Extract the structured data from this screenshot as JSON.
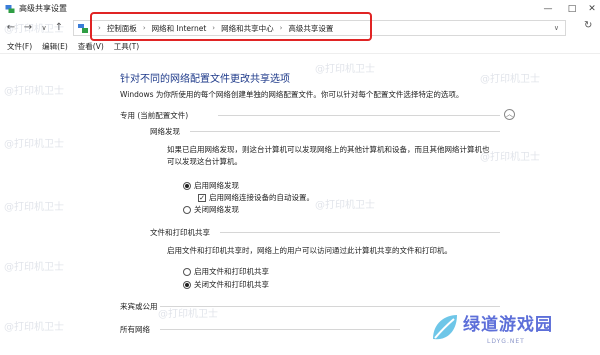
{
  "window": {
    "title": "高级共享设置"
  },
  "address": {
    "breadcrumbs": [
      "控制面板",
      "网络和 Internet",
      "网络和共享中心",
      "高级共享设置"
    ]
  },
  "menu": [
    "文件(F)",
    "编辑(E)",
    "查看(V)",
    "工具(T)"
  ],
  "page": {
    "title": "针对不同的网络配置文件更改共享选项",
    "description": "Windows 为你所使用的每个网络创建单独的网络配置文件。你可以针对每个配置文件选择特定的选项。",
    "private_profile": {
      "header": "专用 (当前配置文件)",
      "network_discovery": {
        "title": "网络发现",
        "text_line1": "如果已启用网络发现，则这台计算机可以发现网络上的其他计算机和设备，而且其他网络计算机也",
        "text_line2": "可以发现这台计算机。",
        "options": [
          {
            "label": "启用网络发现",
            "selected": true
          },
          {
            "label": "关闭网络发现",
            "selected": false
          }
        ],
        "auto_setup": {
          "label": "启用网络连接设备的自动设置。",
          "checked": true
        }
      },
      "file_printer_sharing": {
        "title": "文件和打印机共享",
        "text": "启用文件和打印机共享时，网络上的用户可以访问通过此计算机共享的文件和打印机。",
        "options": [
          {
            "label": "启用文件和打印机共享",
            "selected": false
          },
          {
            "label": "关闭文件和打印机共享",
            "selected": true
          }
        ]
      }
    },
    "guest_public": {
      "header": "来宾或公用"
    },
    "all_networks": {
      "header": "所有网络"
    }
  },
  "watermark": "@打印机卫士",
  "logo": {
    "text": "绿道游戏园",
    "sub": "LDYG.NET"
  },
  "colors": {
    "accent": "#1e3a8a",
    "highlight": "#e02424",
    "logo": "#5d6fd9"
  }
}
